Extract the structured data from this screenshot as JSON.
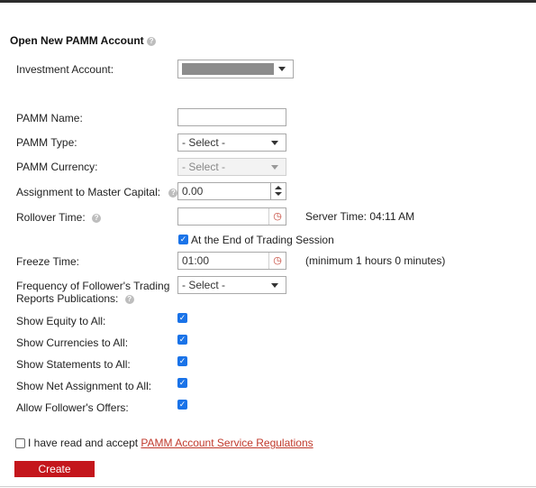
{
  "header": {
    "title": "Open New PAMM Account",
    "help_icon": "question-circle-icon"
  },
  "fields": {
    "investment_account": {
      "label": "Investment Account:",
      "value": ""
    },
    "pamm_name": {
      "label": "PAMM Name:",
      "value": ""
    },
    "pamm_type": {
      "label": "PAMM Type:",
      "value": "- Select -"
    },
    "pamm_currency": {
      "label": "PAMM Currency:",
      "value": "- Select -"
    },
    "assignment": {
      "label": "Assignment to Master Capital:",
      "value": "0.00"
    },
    "rollover": {
      "label": "Rollover Time:",
      "value": "",
      "server_time": "Server Time: 04:11 AM"
    },
    "end_of_session": {
      "label": "At the End of Trading Session",
      "checked": true
    },
    "freeze": {
      "label": "Freeze Time:",
      "value": "01:00",
      "hint": "(minimum 1 hours 0 minutes)"
    },
    "frequency": {
      "label_line1": "Frequency of Follower's Trading",
      "label_line2": "Reports Publications:",
      "value": "- Select -"
    }
  },
  "checkboxes": [
    {
      "label": "Show Equity to All:",
      "checked": true
    },
    {
      "label": "Show Currencies to All:",
      "checked": true
    },
    {
      "label": "Show Statements to All:",
      "checked": true
    },
    {
      "label": "Show Net Assignment to All:",
      "checked": true
    },
    {
      "label": "Allow Follower's Offers:",
      "checked": true
    }
  ],
  "terms": {
    "text": "I have read and accept ",
    "link": "PAMM Account Service Regulations",
    "checked": false
  },
  "actions": {
    "create_label": "Create"
  },
  "colors": {
    "accent": "#c4161c",
    "checkbox": "#1a73e8",
    "link": "#c0392b"
  }
}
